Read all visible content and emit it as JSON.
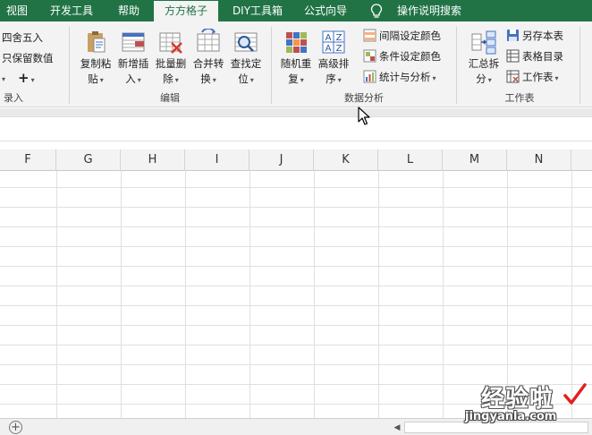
{
  "tabs": [
    "视图",
    "开发工具",
    "帮助",
    "方方格子",
    "DIY工具箱",
    "公式向导",
    "操作说明搜索"
  ],
  "active_tab": "方方格子",
  "ribbon": {
    "left_partial": {
      "round_label": "四舍五入",
      "keep_value_label": "只保留数值",
      "plus_label": "+",
      "group_label": "录入"
    },
    "edit_group": {
      "label": "编辑",
      "buttons": [
        {
          "line1": "复制粘",
          "line2": "贴",
          "icon": "clipboard-icon"
        },
        {
          "line1": "新增插",
          "line2": "入",
          "icon": "insert-rows-icon"
        },
        {
          "line1": "批量删",
          "line2": "除",
          "icon": "batch-delete-icon"
        },
        {
          "line1": "合并转",
          "line2": "换",
          "icon": "merge-convert-icon"
        },
        {
          "line1": "查找定",
          "line2": "位",
          "icon": "find-locate-icon"
        }
      ]
    },
    "data_group": {
      "label": "数据分析",
      "buttons": [
        {
          "line1": "随机重",
          "line2": "复",
          "icon": "random-repeat-icon"
        },
        {
          "line1": "高级排",
          "line2": "序",
          "icon": "advanced-sort-icon"
        }
      ],
      "small": [
        {
          "label": "间隔设定颜色",
          "icon": "interval-color-icon"
        },
        {
          "label": "条件设定颜色",
          "icon": "condition-color-icon"
        },
        {
          "label": "统计与分析",
          "icon": "statistics-icon"
        }
      ]
    },
    "sheet_group": {
      "label": "工作表",
      "big": {
        "line1": "汇总拆",
        "line2": "分",
        "icon": "summarize-split-icon"
      },
      "small": [
        {
          "label": "另存本表",
          "icon": "save-sheet-icon"
        },
        {
          "label": "表格目录",
          "icon": "table-directory-icon"
        },
        {
          "label": "工作表",
          "icon": "worksheet-icon"
        }
      ]
    }
  },
  "columns": [
    "F",
    "G",
    "H",
    "I",
    "J",
    "K",
    "L",
    "M",
    "N"
  ],
  "watermark": {
    "text": "经验啦",
    "url": "jingyanla.com"
  },
  "colors": {
    "tabbar": "#217346",
    "ribbon": "#f3f3f3",
    "gridline": "#e0e0e0"
  }
}
